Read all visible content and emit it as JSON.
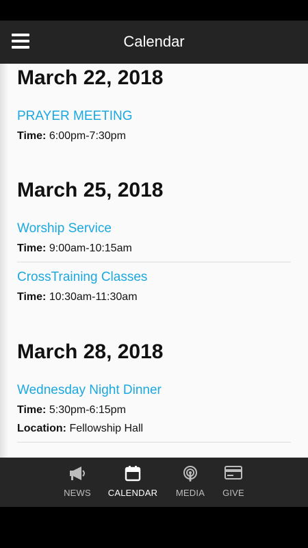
{
  "header": {
    "title": "Calendar",
    "menu_icon": "hamburger-menu-icon"
  },
  "days": [
    {
      "date": "March 22, 2018",
      "events": [
        {
          "title": "PRAYER MEETING",
          "time_label": "Time:",
          "time": "6:00pm-7:30pm"
        }
      ]
    },
    {
      "date": "March 25, 2018",
      "events": [
        {
          "title": "Worship Service",
          "time_label": "Time:",
          "time": "9:00am-10:15am"
        },
        {
          "title": "CrossTraining Classes",
          "time_label": "Time:",
          "time": "10:30am-11:30am"
        }
      ]
    },
    {
      "date": "March 28, 2018",
      "events": [
        {
          "title": "Wednesday Night Dinner",
          "time_label": "Time:",
          "time": "5:30pm-6:15pm",
          "location_label": "Location:",
          "location": "Fellowship Hall"
        }
      ]
    }
  ],
  "tabs": [
    {
      "label": "NEWS",
      "icon": "megaphone-icon",
      "active": false
    },
    {
      "label": "CALENDAR",
      "icon": "calendar-icon",
      "active": true
    },
    {
      "label": "MEDIA",
      "icon": "podcast-icon",
      "active": false
    },
    {
      "label": "GIVE",
      "icon": "credit-card-icon",
      "active": false
    }
  ],
  "colors": {
    "accent": "#1ba8e0",
    "appbar": "#242424",
    "bottombar": "#262626",
    "background": "#fafafa"
  }
}
